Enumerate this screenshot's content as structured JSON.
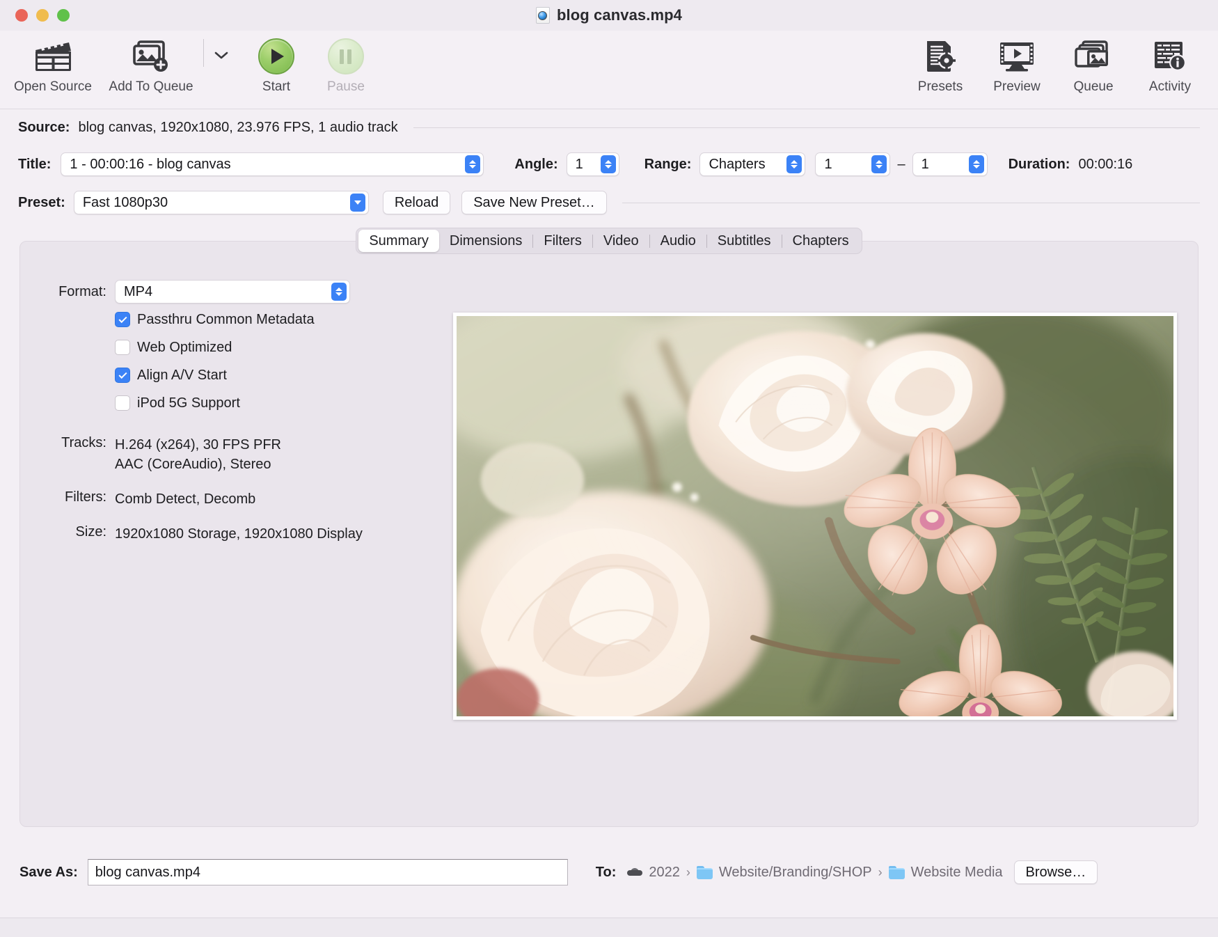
{
  "window": {
    "title": "blog canvas.mp4",
    "doc_icon": "handbrake-document-icon",
    "traffic_lights": [
      "close",
      "minimize",
      "zoom"
    ]
  },
  "toolbar": {
    "left_items": [
      {
        "label": "Open Source",
        "icon": "clapperboard-icon",
        "enabled": true
      },
      {
        "label": "Add To Queue",
        "icon": "add-image-stack-icon",
        "enabled": true,
        "has_dropdown": true
      },
      {
        "label": "Start",
        "icon": "play-circle-icon",
        "enabled": true
      },
      {
        "label": "Pause",
        "icon": "pause-circle-icon",
        "enabled": false
      }
    ],
    "right_items": [
      {
        "label": "Presets",
        "icon": "document-gear-icon",
        "enabled": true
      },
      {
        "label": "Preview",
        "icon": "monitor-play-icon",
        "enabled": true
      },
      {
        "label": "Queue",
        "icon": "image-stack-icon",
        "enabled": true
      },
      {
        "label": "Activity",
        "icon": "log-info-icon",
        "enabled": true
      }
    ]
  },
  "source": {
    "label": "Source:",
    "value": "blog canvas, 1920x1080, 23.976 FPS, 1 audio track"
  },
  "title_row": {
    "label": "Title:",
    "value": "1 - 00:00:16 - blog canvas",
    "angle_label": "Angle:",
    "angle_value": "1",
    "range_label": "Range:",
    "range_type": "Chapters",
    "range_start": "1",
    "range_dash": "–",
    "range_end": "1",
    "duration_label": "Duration:",
    "duration_value": "00:00:16"
  },
  "preset_row": {
    "label": "Preset:",
    "value": "Fast 1080p30",
    "reload_label": "Reload",
    "save_preset_label": "Save New Preset…"
  },
  "tabs": [
    {
      "label": "Summary",
      "active": true
    },
    {
      "label": "Dimensions",
      "active": false
    },
    {
      "label": "Filters",
      "active": false
    },
    {
      "label": "Video",
      "active": false
    },
    {
      "label": "Audio",
      "active": false
    },
    {
      "label": "Subtitles",
      "active": false
    },
    {
      "label": "Chapters",
      "active": false
    }
  ],
  "summary": {
    "format_label": "Format:",
    "format_value": "MP4",
    "checkboxes": [
      {
        "label": "Passthru Common Metadata",
        "checked": true
      },
      {
        "label": "Web Optimized",
        "checked": false
      },
      {
        "label": "Align A/V Start",
        "checked": true
      },
      {
        "label": "iPod 5G Support",
        "checked": false
      }
    ],
    "tracks_label": "Tracks:",
    "tracks_line1": "H.264 (x264), 30 FPS PFR",
    "tracks_line2": "AAC (CoreAudio), Stereo",
    "filters_label": "Filters:",
    "filters_value": "Comb Detect, Decomb",
    "size_label": "Size:",
    "size_value": "1920x1080 Storage, 1920x1080 Display",
    "preview_alt": "video-preview-frame-roses-and-orchids"
  },
  "bottom": {
    "save_as_label": "Save As:",
    "save_as_value": "blog canvas.mp4",
    "to_label": "To:",
    "path": [
      {
        "name": "2022",
        "icon": "disk-icon"
      },
      {
        "name": "Website/Branding/SHOP",
        "icon": "folder-icon"
      },
      {
        "name": "Website Media",
        "icon": "folder-icon"
      }
    ],
    "path_separator": "›",
    "browse_label": "Browse…"
  },
  "colors": {
    "window_bg": "#f3eff4",
    "panel_bg": "#eae5ec",
    "accent_blue": "#3b82f6",
    "start_green": "#7bb84b",
    "text": "#1d1d20",
    "muted_text": "#6f6a73"
  }
}
